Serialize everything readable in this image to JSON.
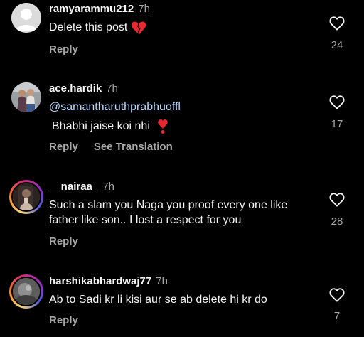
{
  "comments": [
    {
      "username": "ramyarammu212",
      "time": "7h",
      "text": "Delete this post",
      "reply_label": "Reply",
      "likes": "24"
    },
    {
      "username": "ace.hardik",
      "time": "7h",
      "mention": "@samantharuthprabhuoffl",
      "text": "Bhabhi jaise koi nhi",
      "reply_label": "Reply",
      "translate_label": "See Translation",
      "likes": "17"
    },
    {
      "username": "__nairaa_",
      "time": "7h",
      "text": "Such a slam you Naga you proof every one like father like son.. I lost a respect for you",
      "reply_label": "Reply",
      "likes": "28"
    },
    {
      "username": "harshikabhardwaj77",
      "time": "7h",
      "text": "Ab to Sadi kr li kisi aur se ab delete hi kr do",
      "reply_label": "Reply",
      "likes": "7"
    }
  ],
  "colors": {
    "background": "#000000",
    "primary_text": "#f5f5f5",
    "secondary_text": "#a8a8a8",
    "mention": "#e0f1ff"
  },
  "icons": {
    "like": "heart-outline-icon",
    "broken_heart": "broken-heart-emoji",
    "heart_exclamation": "heart-exclamation-emoji"
  }
}
